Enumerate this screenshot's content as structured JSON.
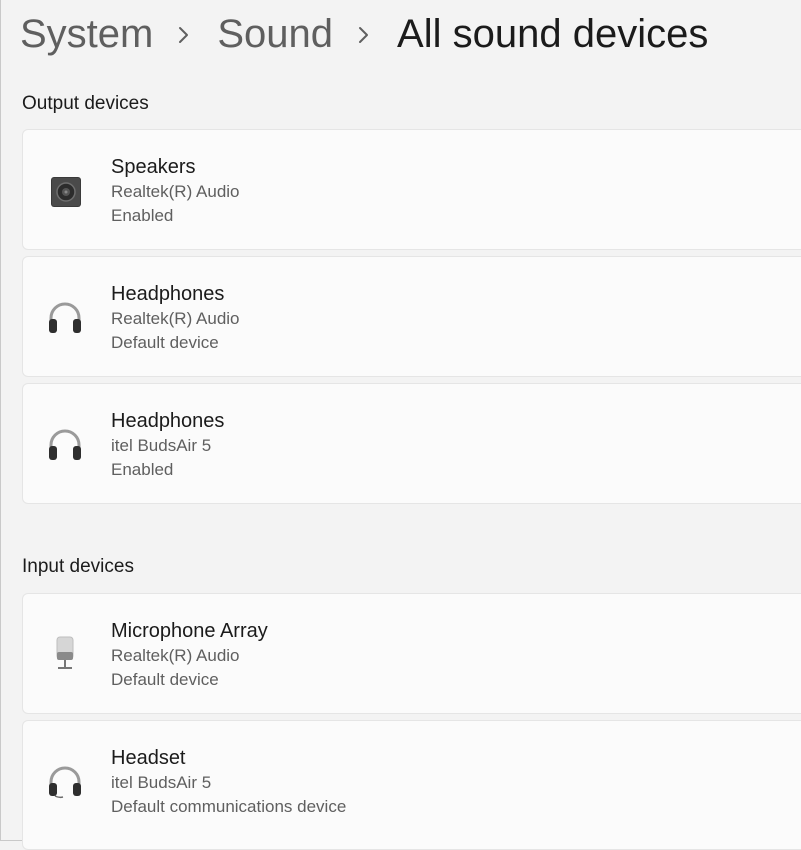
{
  "breadcrumb": {
    "items": [
      "System",
      "Sound",
      "All sound devices"
    ]
  },
  "output": {
    "title": "Output devices",
    "devices": [
      {
        "name": "Speakers",
        "driver": "Realtek(R) Audio",
        "status": "Enabled",
        "icon": "speaker-icon"
      },
      {
        "name": "Headphones",
        "driver": "Realtek(R) Audio",
        "status": "Default device",
        "icon": "headphones-icon"
      },
      {
        "name": "Headphones",
        "driver": "itel BudsAir 5",
        "status": "Enabled",
        "icon": "headphones-icon"
      }
    ]
  },
  "input": {
    "title": "Input devices",
    "devices": [
      {
        "name": "Microphone Array",
        "driver": "Realtek(R) Audio",
        "status": "Default device",
        "icon": "microphone-icon"
      },
      {
        "name": "Headset",
        "driver": "itel BudsAir 5",
        "status": "Default communications device",
        "icon": "headset-icon"
      }
    ]
  }
}
